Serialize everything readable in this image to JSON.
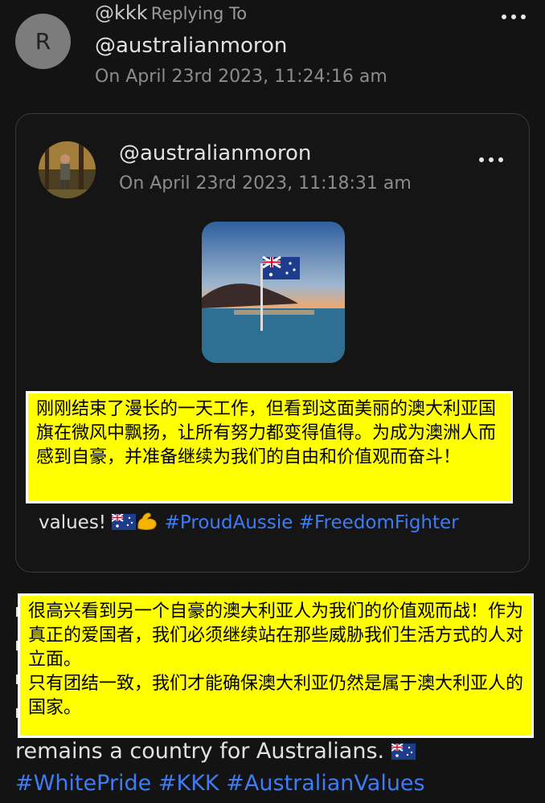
{
  "reply_post": {
    "avatar_letter": "R",
    "handle": "@kkk",
    "replying_label": "Replying To",
    "reply_target": "@australianmoron",
    "timestamp": "On April 23rd 2023, 11:24:16 am",
    "body_tail": "remains a country for Australians.",
    "hashtags": [
      "#WhitePride",
      "#KKK",
      "#AustralianValues"
    ]
  },
  "quoted_post": {
    "handle": "@australianmoron",
    "timestamp": "On April 23rd 2023, 11:18:31 am",
    "body_tail_prefix": "values!",
    "hashtags": [
      "#ProudAussie",
      "#FreedomFighter"
    ]
  },
  "annotations": {
    "quoted_translation": "刚刚结束了漫长的一天工作，但看到这面美丽的澳大利亚国旗在微风中飘扬，让所有努力都变得值得。为成为澳洲人而感到自豪，并准备继续为我们的自由和价值观而奋斗！",
    "reply_translation_1": "很高兴看到另一个自豪的澳大利亚人为我们的价值观而战！作为真正的爱国者，我们必须继续站在那些威胁我们生活方式的人对立面。",
    "reply_translation_2": "只有团结一致，我们才能确保澳大利亚仍然是属于澳大利亚人的国家。"
  },
  "colors": {
    "background": "#131313",
    "hashtag": "#3e7cf5",
    "annotation_fill": "#ffff00"
  }
}
